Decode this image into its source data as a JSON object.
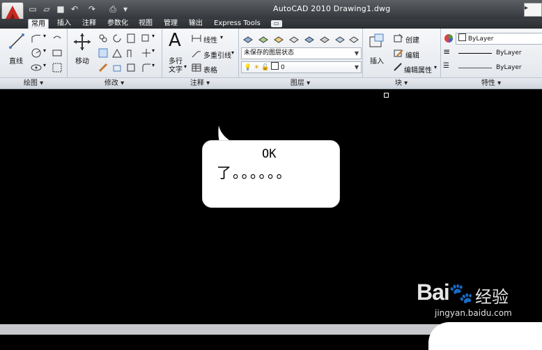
{
  "window": {
    "title": "AutoCAD 2010    Drawing1.dwg"
  },
  "quick_access": {
    "icons": [
      "new-icon",
      "open-icon",
      "save-icon",
      "undo-icon",
      "redo-icon",
      "print-icon",
      "dropdown-icon"
    ]
  },
  "tabs": [
    {
      "label": "常用"
    },
    {
      "label": "插入"
    },
    {
      "label": "注释"
    },
    {
      "label": "参数化"
    },
    {
      "label": "视图"
    },
    {
      "label": "管理"
    },
    {
      "label": "输出"
    },
    {
      "label": "Express Tools"
    }
  ],
  "ribbon": {
    "draw": {
      "title": "绘图",
      "line_label": "直线"
    },
    "modify": {
      "title": "修改",
      "move_label": "移动"
    },
    "annotation": {
      "title": "注释",
      "mtext_label_1": "多行",
      "mtext_label_2": "文字",
      "linear_label": "线性",
      "mleader_label": "多重引线",
      "table_label": "表格"
    },
    "layers": {
      "title": "图层",
      "state_value": "未保存的图层状态",
      "current_layer": "0"
    },
    "block": {
      "title": "块",
      "insert_label": "插入",
      "create_label": "创建",
      "edit_label": "编辑",
      "edit_attr_label": "编辑属性"
    },
    "properties": {
      "title": "特性",
      "color_value": "ByLayer",
      "linetype_value": "ByLayer",
      "lineweight_value": "ByLayer"
    }
  },
  "bubble": {
    "line1": "OK",
    "line2": "了。。。。。。"
  },
  "watermark": {
    "logo": "Bai",
    "logo_suffix": "经验",
    "url": "jingyan.baidu.com"
  },
  "colors": {
    "canvas": "#000000",
    "accent_red": "#c8281e"
  }
}
